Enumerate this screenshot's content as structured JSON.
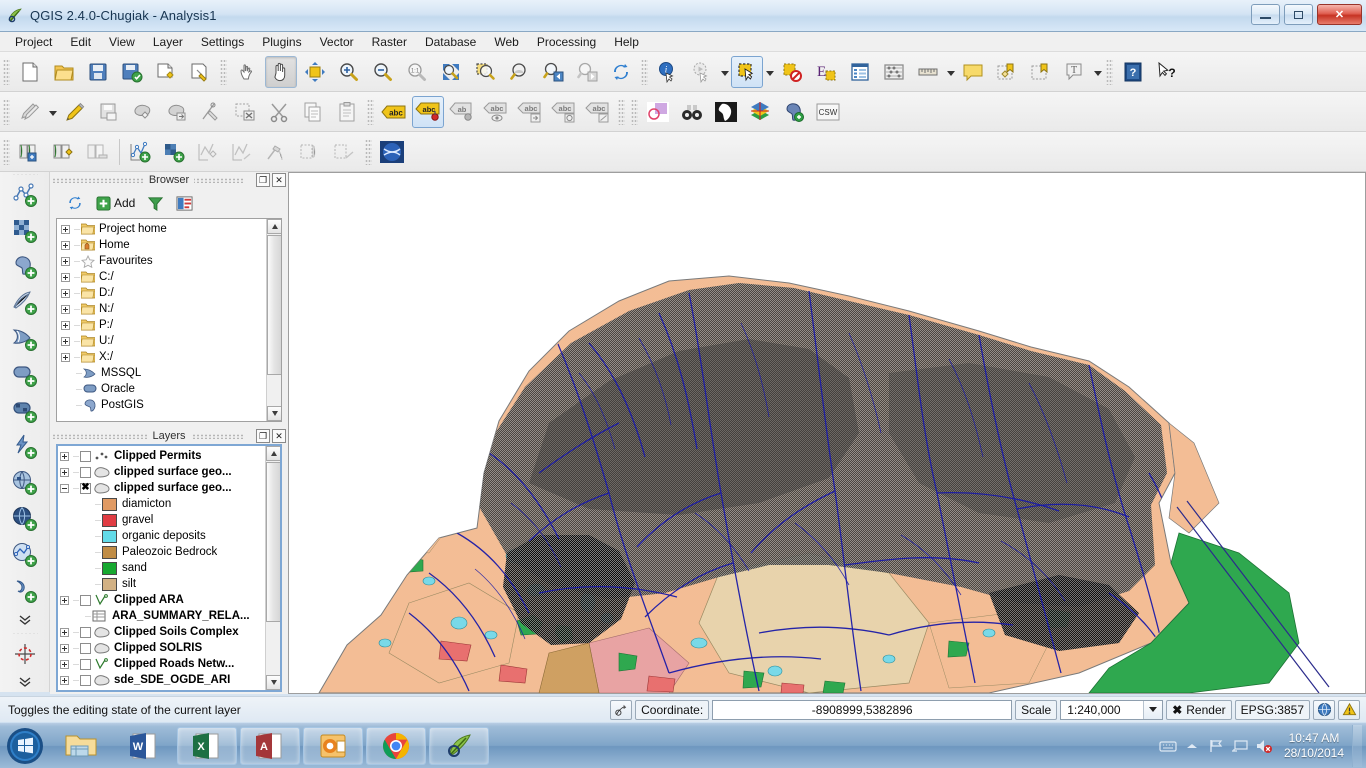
{
  "window": {
    "title": "QGIS 2.4.0-Chugiak - Analysis1",
    "app_icon": "qgis-icon",
    "minimize_label": "",
    "maximize_label": "",
    "close_label": "✕"
  },
  "menubar": {
    "items": [
      {
        "label": "Project",
        "name": "menu-project"
      },
      {
        "label": "Edit",
        "name": "menu-edit"
      },
      {
        "label": "View",
        "name": "menu-view"
      },
      {
        "label": "Layer",
        "name": "menu-layer"
      },
      {
        "label": "Settings",
        "name": "menu-settings"
      },
      {
        "label": "Plugins",
        "name": "menu-plugins"
      },
      {
        "label": "Vector",
        "name": "menu-vector"
      },
      {
        "label": "Raster",
        "name": "menu-raster"
      },
      {
        "label": "Database",
        "name": "menu-database"
      },
      {
        "label": "Web",
        "name": "menu-web"
      },
      {
        "label": "Processing",
        "name": "menu-processing"
      },
      {
        "label": "Help",
        "name": "menu-help"
      }
    ]
  },
  "toolbar_main": {
    "icons": [
      "new-project-icon",
      "open-project-icon",
      "save-project-icon",
      "save-project-as-icon",
      "new-print-composer-icon",
      "composer-manager-icon",
      "touch-zoom-icon",
      "pan-map-icon",
      "pan-to-selection-icon",
      "zoom-in-icon",
      "zoom-out-icon",
      "zoom-full-icon",
      "zoom-native-icon",
      "zoom-to-selection-icon",
      "zoom-to-layer-icon",
      "zoom-last-icon",
      "zoom-next-icon",
      "refresh-icon",
      "identify-features-icon",
      "run-feature-action-icon",
      "select-features-icon",
      "deselect-features-icon",
      "select-by-expression-icon",
      "open-attribute-table-icon",
      "open-field-calculator-icon",
      "measure-line-icon",
      "map-tips-icon",
      "new-bookmark-icon",
      "show-bookmarks-icon",
      "text-annotation-icon",
      "help-contents-icon",
      "whats-this-icon"
    ]
  },
  "toolbar_digitizing": {
    "icons": [
      "current-edits-icon",
      "toggle-editing-icon",
      "save-layer-edits-icon",
      "add-feature-icon",
      "move-feature-icon",
      "node-tool-icon",
      "delete-selected-icon",
      "cut-features-icon",
      "copy-features-icon",
      "paste-features-icon",
      "label-icon",
      "label-pin-icon",
      "label-hide-icon",
      "label-show-hide-icon",
      "label-move-icon",
      "label-rotate-icon",
      "label-change-icon",
      "style-manager-icon",
      "search-binoculars-icon",
      "globe-raster-icon",
      "gdal-tools-icon",
      "postgis-manager-icon",
      "csw-catalog-icon"
    ]
  },
  "toolbar_manage_layers": {
    "icons": [
      "embed-layers-icon",
      "add-layer-from-definition-icon",
      "remove-layer-icon",
      "new-vector-layer-icon",
      "new-memory-layer-icon",
      "new-spatialite-layer-icon",
      "new-gpx-layer-icon",
      "geoprocessing-icon",
      "copy-style-icon",
      "paste-style-icon",
      "openlayers-plugin-icon"
    ]
  },
  "toolbar_add_layer": {
    "icons": [
      "add-vector-layer-icon",
      "add-raster-layer-icon",
      "add-postgis-layer-icon",
      "add-spatialite-layer-icon",
      "add-mssql-layer-icon",
      "add-oracle-layer-icon",
      "add-db2-layer-icon",
      "add-wms-layer-icon",
      "add-wcs-layer-icon",
      "add-wfs-layer-icon",
      "add-delimited-text-layer-icon",
      "expand-more-icon",
      "georeferencer-icon",
      "expand-more-2-icon"
    ]
  },
  "browser_panel": {
    "title": "Browser",
    "float_label": "❐",
    "close_label": "✕",
    "tools": {
      "refresh_icon": "refresh-icon",
      "add_label": "Add",
      "add_icon": "add-green-plus-icon",
      "filter_icon": "filter-funnel-icon",
      "properties_icon": "collapse-all-icon"
    },
    "items": [
      {
        "label": "Project home",
        "icon": "folder-icon",
        "expandable": true
      },
      {
        "label": "Home",
        "icon": "home-folder-icon",
        "expandable": true
      },
      {
        "label": "Favourites",
        "icon": "star-icon",
        "expandable": true
      },
      {
        "label": "C:/",
        "icon": "folder-icon",
        "expandable": true
      },
      {
        "label": "D:/",
        "icon": "folder-icon",
        "expandable": true
      },
      {
        "label": "N:/",
        "icon": "folder-icon",
        "expandable": true
      },
      {
        "label": "P:/",
        "icon": "folder-icon",
        "expandable": true
      },
      {
        "label": "U:/",
        "icon": "folder-icon",
        "expandable": true
      },
      {
        "label": "X:/",
        "icon": "folder-icon",
        "expandable": true
      },
      {
        "label": "MSSQL",
        "icon": "mssql-icon",
        "expandable": false
      },
      {
        "label": "Oracle",
        "icon": "oracle-icon",
        "expandable": false
      },
      {
        "label": "PostGIS",
        "icon": "postgis-elephant-icon",
        "expandable": false
      }
    ]
  },
  "layers_panel": {
    "title": "Layers",
    "float_label": "❐",
    "close_label": "✕",
    "items": [
      {
        "label": "Clipped Permits",
        "type": "point",
        "bold": true,
        "checked": false,
        "expandable": "plus",
        "indent": 1
      },
      {
        "label": "clipped surface geo...",
        "type": "polygon",
        "bold": true,
        "checked": false,
        "expandable": "plus",
        "indent": 1
      },
      {
        "label": "clipped surface geo...",
        "type": "polygon",
        "bold": true,
        "checked": true,
        "expandable": "minus",
        "indent": 1
      },
      {
        "label": "diamicton",
        "type": "swatch",
        "color": "#e09a63",
        "bold": false,
        "indent": 3
      },
      {
        "label": "gravel",
        "type": "swatch",
        "color": "#e03c43",
        "bold": false,
        "indent": 3
      },
      {
        "label": "organic deposits",
        "type": "swatch",
        "color": "#63dbe8",
        "bold": false,
        "indent": 3
      },
      {
        "label": "Paleozoic Bedrock",
        "type": "swatch",
        "color": "#c08c45",
        "bold": false,
        "indent": 3
      },
      {
        "label": "sand",
        "type": "swatch",
        "color": "#17a830",
        "bold": false,
        "indent": 3
      },
      {
        "label": "silt",
        "type": "swatch",
        "color": "#d2b184",
        "bold": false,
        "indent": 3
      },
      {
        "label": "Clipped ARA",
        "type": "line",
        "bold": true,
        "checked": false,
        "expandable": "plus",
        "indent": 1
      },
      {
        "label": "ARA_SUMMARY_RELA...",
        "type": "table",
        "bold": true,
        "indent": 2
      },
      {
        "label": "Clipped Soils Complex",
        "type": "polygon",
        "bold": true,
        "checked": false,
        "expandable": "plus",
        "indent": 1
      },
      {
        "label": "Clipped SOLRIS",
        "type": "polygon",
        "bold": true,
        "checked": false,
        "expandable": "plus",
        "indent": 1
      },
      {
        "label": "Clipped Roads Netw...",
        "type": "line",
        "bold": true,
        "checked": false,
        "expandable": "plus",
        "indent": 1
      },
      {
        "label": "sde_SDE_OGDE_ARI",
        "type": "polygon",
        "bold": true,
        "checked": false,
        "expandable": "plus",
        "indent": 1
      }
    ]
  },
  "map": {
    "name": "map-canvas",
    "background": "#ffffff",
    "legend_colors": {
      "diamicton": "#f0bb95",
      "gravel": "#e8706f",
      "organic_deposits": "#79d9e8",
      "paleozoic_bedrock": "#c9a062",
      "sand": "#2eaa4e",
      "silt": "#e3cfa8",
      "overlay_dark": "#3a3a3a",
      "stream": "#1a1aa8",
      "road": "#2b2b8c"
    }
  },
  "statusbar": {
    "message": "Toggles the editing state of the current layer",
    "coordinate_toggle_icon": "coordinate-capture-icon",
    "coordinate_label": "Coordinate:",
    "coordinate_value": "-8908999,5382896",
    "scale_label": "Scale",
    "scale_value": "1:240,000",
    "render_label": "Render",
    "render_checked": true,
    "crs_label": "EPSG:3857",
    "crs_button_icon": "crs-globe-icon",
    "messages_icon": "warning-triangle-icon"
  },
  "taskbar": {
    "start_icon": "windows-start-orb-icon",
    "apps": [
      {
        "name": "file-explorer",
        "icon": "explorer-icon",
        "open": false
      },
      {
        "name": "microsoft-word",
        "icon": "word-icon",
        "open": false
      },
      {
        "name": "microsoft-excel",
        "icon": "excel-icon",
        "open": true
      },
      {
        "name": "microsoft-access",
        "icon": "access-icon",
        "open": true
      },
      {
        "name": "microsoft-outlook",
        "icon": "outlook-icon",
        "open": true
      },
      {
        "name": "google-chrome",
        "icon": "chrome-icon",
        "open": true
      },
      {
        "name": "qgis",
        "icon": "qgis-icon",
        "open": true
      }
    ],
    "tray": [
      "keyboard-icon",
      "show-hidden-icon",
      "network-flag-icon",
      "network-icon",
      "volume-muted-icon"
    ],
    "clock_time": "10:47 AM",
    "clock_date": "28/10/2014"
  }
}
